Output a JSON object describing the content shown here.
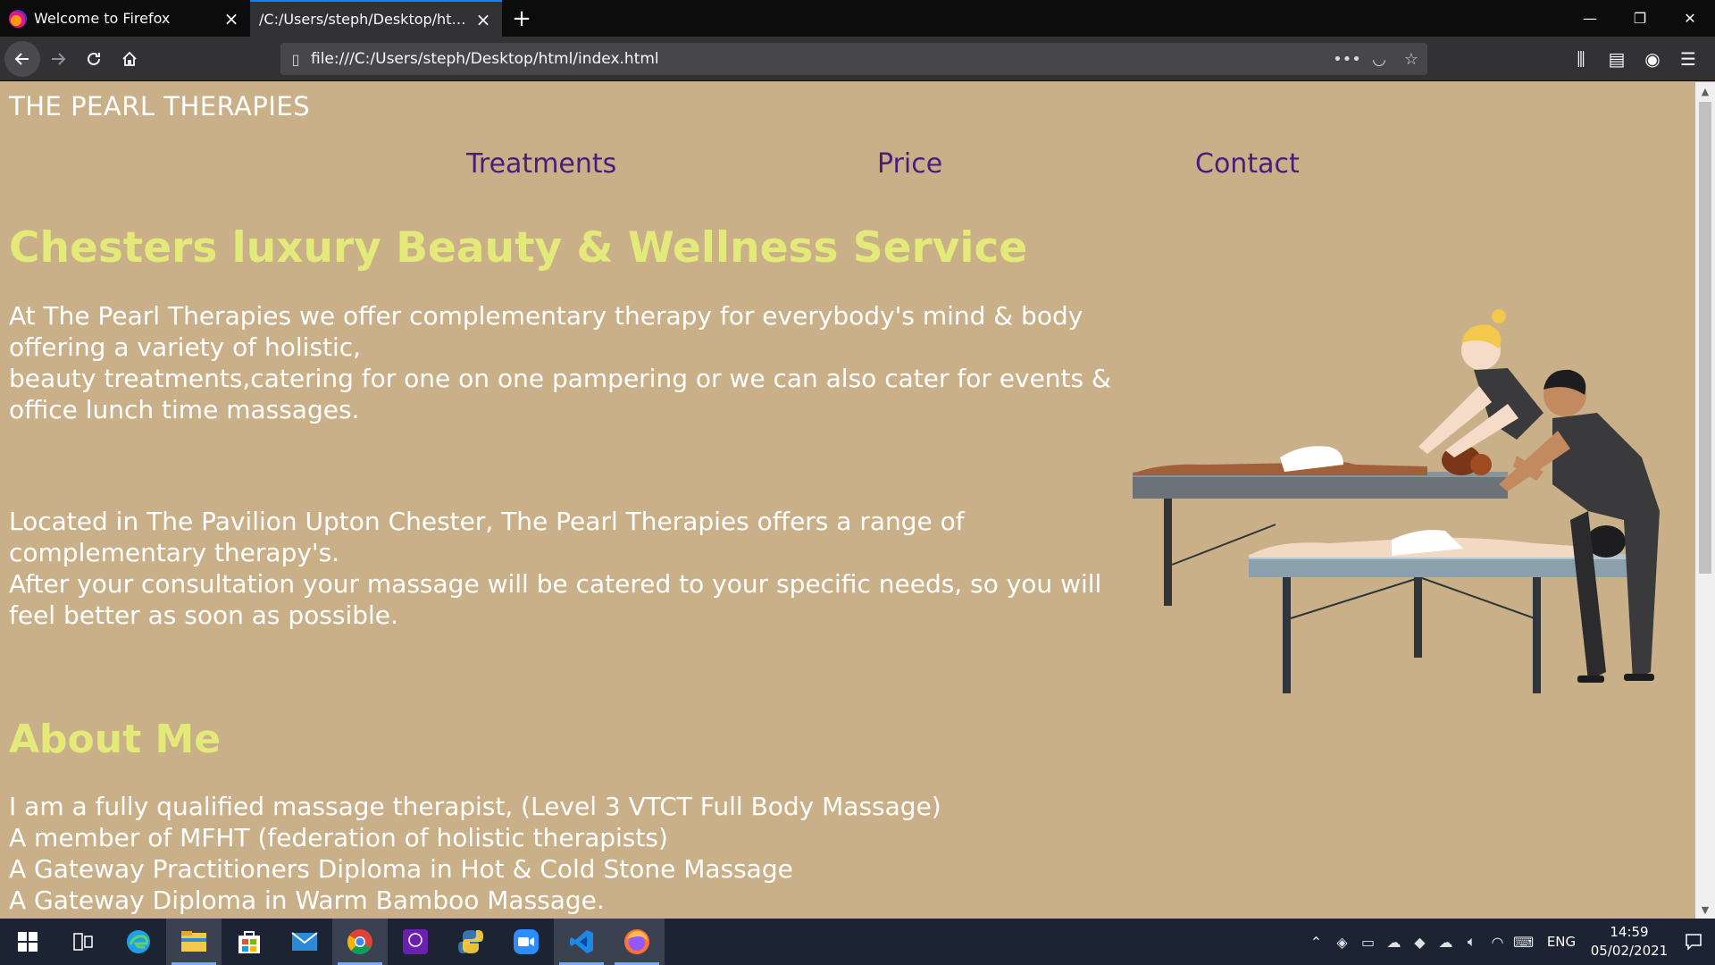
{
  "browser": {
    "tabs": [
      {
        "label": "Welcome to Firefox",
        "active": false
      },
      {
        "label": "/C:/Users/steph/Desktop/html/index.html",
        "active": true
      }
    ],
    "new_tab": "+",
    "url": "file:///C:/Users/steph/Desktop/html/index.html",
    "window_controls": {
      "minimize": "—",
      "restore": "❐",
      "close": "✕"
    },
    "icons": [
      "back-icon",
      "forward-icon",
      "reload-icon",
      "home-icon",
      "page-icon",
      "more-actions-icon",
      "pocket-icon",
      "bookmark-star-icon",
      "library-icon",
      "sidebar-icon",
      "account-icon",
      "menu-icon"
    ]
  },
  "site": {
    "title": "THE PEARL THERAPIES",
    "nav": [
      "Treatments",
      "Price",
      "Contact"
    ],
    "heading": "Chesters luxury Beauty & Wellness Service",
    "intro": [
      "At The Pearl Therapies we offer complementary therapy for everybody's mind & body offering a variety of holistic,",
      "beauty treatments,catering for one on one pampering or we can also cater for events & office lunch time massages."
    ],
    "location": [
      "Located in The Pavilion Upton Chester, The Pearl Therapies offers a range of complementary therapy's.",
      "After your consultation your massage will be catered to your specific needs, so you will feel better as soon as possible."
    ],
    "about_heading": "About Me",
    "about_lines": [
      "I am a fully qualified massage therapist, (Level 3 VTCT Full Body Massage)",
      "A member of MFHT (federation of holistic therapists)",
      "A Gateway Practitioners Diploma in Hot & Cold Stone Massage",
      "A Gateway Diploma in Warm Bamboo Massage."
    ],
    "colors": {
      "background": "#c9b088",
      "heading": "#e3ea7a",
      "nav_link": "#4b1d7a",
      "text": "#ffffff"
    }
  },
  "taskbar": {
    "apps": [
      "windows-start-icon",
      "task-view-icon",
      "edge-icon",
      "file-explorer-icon",
      "store-icon",
      "mail-icon",
      "chrome-icon",
      "bt-sport-icon",
      "python-icon",
      "zoom-icon",
      "vscode-icon",
      "firefox-icon"
    ],
    "language": "ENG",
    "time": "14:59",
    "date": "05/02/2021"
  }
}
